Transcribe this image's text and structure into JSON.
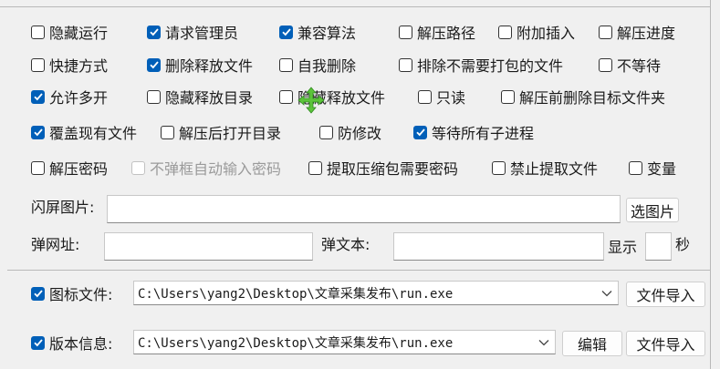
{
  "options": {
    "row1": [
      {
        "label": "隐藏运行",
        "checked": false
      },
      {
        "label": "请求管理员",
        "checked": true
      },
      {
        "label": "兼容算法",
        "checked": true
      },
      {
        "label": "解压路径",
        "checked": false
      },
      {
        "label": "附加插入",
        "checked": false
      },
      {
        "label": "解压进度",
        "checked": false
      }
    ],
    "row2": [
      {
        "label": "快捷方式",
        "checked": false
      },
      {
        "label": "删除释放文件",
        "checked": true
      },
      {
        "label": "自我删除",
        "checked": false
      },
      {
        "label": "排除不需要打包的文件",
        "checked": false
      },
      {
        "label": "不等待",
        "checked": false
      }
    ],
    "row3": [
      {
        "label": "允许多开",
        "checked": true
      },
      {
        "label": "隐藏释放目录",
        "checked": false
      },
      {
        "label": "隐藏释放文件",
        "checked": false
      },
      {
        "label": "只读",
        "checked": false
      },
      {
        "label": "解压前删除目标文件夹",
        "checked": false
      }
    ],
    "row4": [
      {
        "label": "覆盖现有文件",
        "checked": true
      },
      {
        "label": "解压后打开目录",
        "checked": false
      },
      {
        "label": "防修改",
        "checked": false
      },
      {
        "label": "等待所有子进程",
        "checked": true
      }
    ],
    "row5": [
      {
        "label": "解压密码",
        "checked": false
      },
      {
        "label": "不弹框自动输入密码",
        "checked": false,
        "disabled": true
      },
      {
        "label": "提取压缩包需要密码",
        "checked": false
      },
      {
        "label": "禁止提取文件",
        "checked": false
      },
      {
        "label": "变量",
        "checked": false
      }
    ]
  },
  "splash": {
    "label": "闪屏图片:",
    "value": "",
    "button": "选图片"
  },
  "popup": {
    "url_label": "弹网址:",
    "url_value": "",
    "text_label": "弹文本:",
    "text_value": "",
    "show_label": "显示",
    "show_value": "",
    "unit": "秒"
  },
  "icon_file": {
    "label": "图标文件:",
    "checked": true,
    "value": "C:\\Users\\yang2\\Desktop\\文章采集发布\\run.exe",
    "import_button": "文件导入"
  },
  "version_info": {
    "label": "版本信息:",
    "checked": true,
    "value": "C:\\Users\\yang2\\Desktop\\文章采集发布\\run.exe",
    "edit_button": "编辑",
    "import_button": "文件导入"
  },
  "colors": {
    "accent": "#005fb8",
    "move_cursor": "#5cc43a"
  }
}
